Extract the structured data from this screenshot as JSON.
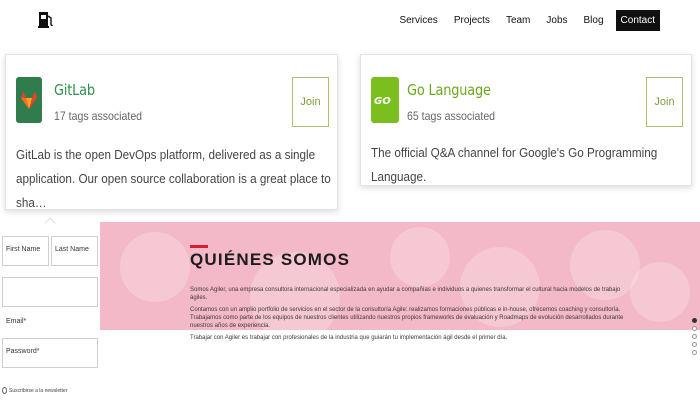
{
  "nav": {
    "logo_icon": "fuel-pump-icon",
    "links": [
      "Services",
      "Projects",
      "Team",
      "Jobs",
      "Blog"
    ],
    "contact_label": "Contact"
  },
  "cards": [
    {
      "title": "GitLab",
      "tags": "17 tags associated",
      "join": "Join",
      "description": "GitLab is the open DevOps platform, delivered as a single application. Our open source collaboration is a great place to sha…",
      "icon": "gitlab-fox-icon",
      "icon_color": "#2f7d4d",
      "title_color": "#2f8f4e"
    },
    {
      "title": "Go Language",
      "tags": "65 tags associated",
      "join": "Join",
      "description": "The official Q&A channel for Google's Go Programming Language.",
      "icon": "go-gopher-icon",
      "icon_color": "#7bbf1f",
      "title_color": "#6aa81b"
    }
  ],
  "hero": {
    "title": "QUIÉNES SOMOS",
    "paragraphs": [
      "Somos Agiler, una empresa consultora internacional especializada en ayudar a compañías e individuos a quienes transformar el cultural hacia modelos de trabajo ágiles.",
      "Contamos con un amplio portfolio de servicios en el sector de la consultoría Agile: realizamos formaciones públicas e in-house, ofrecemos coaching y consultoría. Trabajamos como parte de los equipos de nuestros clientes utilizando nuestros propios frameworks de evaluación y Roadmaps de evolución desarrollados durante nuestros años de experiencia.",
      "Trabajar con Agiler es trabajar con profesionales de la industria que guiarán tu implementación ágil desde el primer día."
    ],
    "background": "#f3b9c8",
    "accent": "#d91f2e"
  },
  "form": {
    "first_name": "First Name",
    "last_name": "Last Name",
    "email_label": "Email*",
    "password": "Password*",
    "checkbox_label": "Suscribirse a la newsletter"
  },
  "carousel": {
    "dots": 5,
    "active": 1
  }
}
